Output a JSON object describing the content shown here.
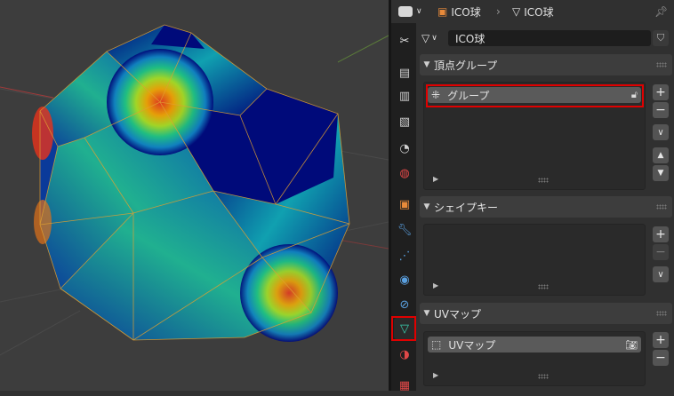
{
  "header": {
    "breadcrumb_object": "ICO球",
    "breadcrumb_mesh": "ICO球"
  },
  "mesh_datablock": {
    "name": "ICO球"
  },
  "panels": {
    "vertex_groups": {
      "title": "頂点グループ",
      "items": [
        {
          "label": "グループ"
        }
      ]
    },
    "shape_keys": {
      "title": "シェイプキー"
    },
    "uv_maps": {
      "title": "UVマップ",
      "items": [
        {
          "label": "UVマップ"
        }
      ]
    }
  },
  "colors": {
    "highlight": "#e00000",
    "active_tab": "#1f9e8e",
    "mesh_low": "#000a7a",
    "mesh_high": "#e8321a"
  },
  "icons": {
    "tabs": [
      "tool-icon",
      "render-icon",
      "output-icon",
      "view-layer-icon",
      "scene-icon",
      "world-icon",
      "object-icon",
      "modifier-icon",
      "particles-icon",
      "physics-icon",
      "constraints-icon",
      "data-icon",
      "material-icon",
      "texture-icon"
    ]
  }
}
